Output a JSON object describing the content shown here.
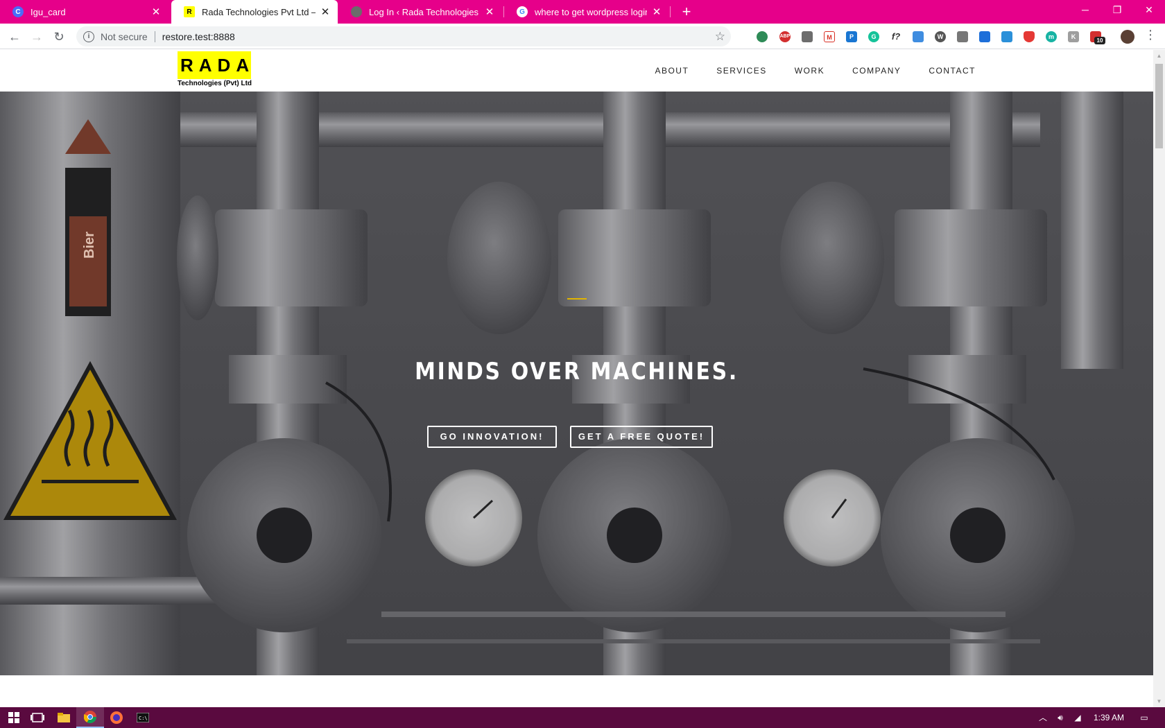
{
  "browser": {
    "tabs": [
      {
        "title": "Igu_card",
        "favicon": "C",
        "favicon_color": "#4b6cf7"
      },
      {
        "title": "Rada Technologies Pvt Ltd – Auto",
        "favicon": "R",
        "favicon_color": "#ffff00",
        "active": true
      },
      {
        "title": "Log In ‹ Rada Technologies Pvt Lt",
        "favicon": "",
        "favicon_color": "#666666"
      },
      {
        "title": "where to get wordpress login pa",
        "favicon": "G",
        "favicon_color": "#ffffff"
      }
    ],
    "new_tab_label": "+",
    "security_label": "Not secure",
    "url": "restore.test:8888",
    "extension_badge": "10"
  },
  "site": {
    "logo_text": "RADA",
    "logo_subtext": "Technologies (Pvt) Ltd",
    "nav": [
      "ABOUT",
      "SERVICES",
      "WORK",
      "COMPANY",
      "CONTACT"
    ],
    "headline": "MINDS OVER MACHINES.",
    "cta_primary": "GO INNOVATION!",
    "cta_secondary": "GET A FREE QUOTE!",
    "hero_image_label": "Bier"
  },
  "taskbar": {
    "time": "1:39 AM"
  },
  "colors": {
    "tabbar": "#e6008a",
    "taskbar": "#5a0a3f",
    "logo_bg": "#ffff00",
    "accent": "#e1b400"
  }
}
